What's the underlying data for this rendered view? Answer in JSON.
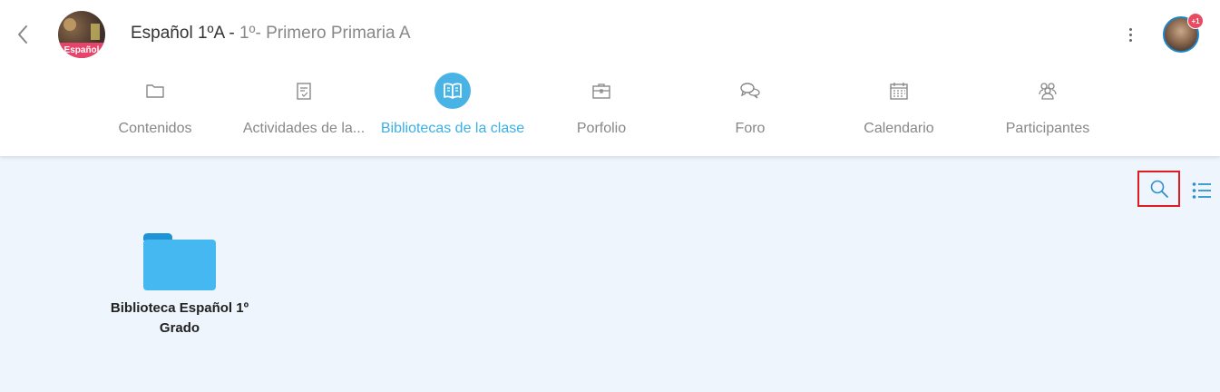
{
  "header": {
    "course_name": "Español 1ºA",
    "separator": " - ",
    "course_group": "1º- Primero Primaria A",
    "course_avatar_label": "Español",
    "notification_badge": "+1"
  },
  "tabs": [
    {
      "label": "Contenidos",
      "icon": "folder-icon",
      "active": false
    },
    {
      "label": "Actividades de la...",
      "icon": "checklist-icon",
      "active": false
    },
    {
      "label": "Bibliotecas de la clase",
      "icon": "book-icon",
      "active": true
    },
    {
      "label": "Porfolio",
      "icon": "briefcase-icon",
      "active": false
    },
    {
      "label": "Foro",
      "icon": "chat-icon",
      "active": false
    },
    {
      "label": "Calendario",
      "icon": "calendar-icon",
      "active": false
    },
    {
      "label": "Participantes",
      "icon": "people-icon",
      "active": false
    }
  ],
  "toolbar": {
    "search_icon": "search-icon",
    "list_icon": "list-view-icon"
  },
  "library": {
    "items": [
      {
        "label": "Biblioteca Español 1º Grado",
        "icon": "folder-icon"
      }
    ]
  },
  "colors": {
    "accent": "#4ab3e6",
    "folder": "#45b8f2",
    "highlight_border": "#e11b22",
    "badge": "#e84a5f",
    "content_bg": "#eef5fc"
  }
}
